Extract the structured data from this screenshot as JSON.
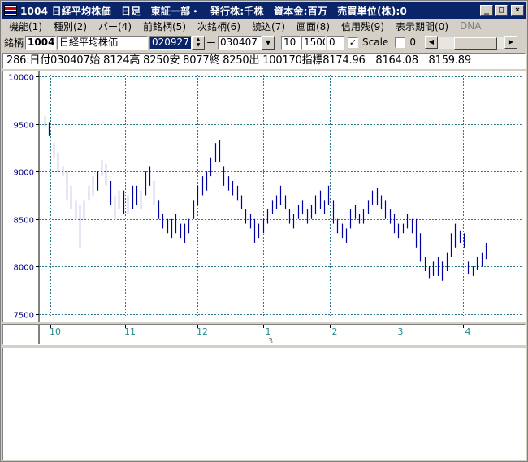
{
  "title": "1004 日経平均株価　日足　東証一部・　発行株:千株　資本金:百万　売買単位(株):0",
  "window_buttons": {
    "minimize": "_",
    "maximize": "□",
    "close": "×"
  },
  "menu": [
    {
      "label": "機能(1)",
      "enabled": true
    },
    {
      "label": "種別(2)",
      "enabled": true
    },
    {
      "label": "バー(4)",
      "enabled": true
    },
    {
      "label": "前銘柄(5)",
      "enabled": true
    },
    {
      "label": "次銘柄(6)",
      "enabled": true
    },
    {
      "label": "読込(7)",
      "enabled": true
    },
    {
      "label": "画面(8)",
      "enabled": true
    },
    {
      "label": "信用残(9)",
      "enabled": true
    },
    {
      "label": "表示期間(0)",
      "enabled": true
    },
    {
      "label": "DNA",
      "enabled": false
    }
  ],
  "toolbar": {
    "stock_label": "銘柄",
    "code": "1004",
    "name": "日経平均株価",
    "date_from": "020927",
    "dash": "ー",
    "date_to": "030407",
    "val1": "10",
    "val2": "1500",
    "val3": "0",
    "scale_checked": "✓",
    "scale_label": "Scale",
    "val4": "0"
  },
  "info_line": "286:日付030407始 8124高 8250安 8077終 8250出 100170指標8174.96　8164.08　8159.89",
  "colors": {
    "bar": "#0000a0",
    "grid": "#2a7a8a",
    "axis_text": "#2a8a8a",
    "price_text": "#000080"
  },
  "chart_data": {
    "type": "bar",
    "subtype": "ohlc-high-low",
    "y_axis": {
      "ticks": [
        10000,
        9500,
        9000,
        8500,
        8000,
        7500
      ],
      "ylim": [
        7480,
        10020
      ]
    },
    "x_axis": {
      "month_labels": [
        "10",
        "11",
        "12",
        "1",
        "2",
        "3",
        "4"
      ],
      "year_label": "3"
    },
    "series": [
      {
        "bars": [
          {
            "high": 9580,
            "low": 9480
          },
          {
            "high": 9520,
            "low": 9380
          },
          {
            "high": 9300,
            "low": 9150
          },
          {
            "high": 9200,
            "low": 9000
          },
          {
            "high": 9050,
            "low": 8950
          },
          {
            "high": 9000,
            "low": 8700
          },
          {
            "high": 8850,
            "low": 8600
          },
          {
            "high": 8700,
            "low": 8500
          },
          {
            "high": 8650,
            "low": 8200
          },
          {
            "high": 8700,
            "low": 8500
          },
          {
            "high": 8850,
            "low": 8700
          },
          {
            "high": 8950,
            "low": 8750
          },
          {
            "high": 9000,
            "low": 8800
          },
          {
            "high": 9120,
            "low": 8950
          },
          {
            "high": 9080,
            "low": 8850
          },
          {
            "high": 8900,
            "low": 8650
          },
          {
            "high": 8750,
            "low": 8500
          },
          {
            "high": 8800,
            "low": 8600
          },
          {
            "high": 8800,
            "low": 8550
          },
          {
            "high": 8750,
            "low": 8550
          },
          {
            "high": 8850,
            "low": 8600
          },
          {
            "high": 8850,
            "low": 8650
          },
          {
            "high": 8800,
            "low": 8600
          },
          {
            "high": 9000,
            "low": 8750
          },
          {
            "high": 9050,
            "low": 8850
          },
          {
            "high": 8900,
            "low": 8650
          },
          {
            "high": 8700,
            "low": 8500
          },
          {
            "high": 8550,
            "low": 8400
          },
          {
            "high": 8500,
            "low": 8350
          },
          {
            "high": 8500,
            "low": 8300
          },
          {
            "high": 8550,
            "low": 8350
          },
          {
            "high": 8450,
            "low": 8300
          },
          {
            "high": 8450,
            "low": 8250
          },
          {
            "high": 8500,
            "low": 8350
          },
          {
            "high": 8700,
            "low": 8500
          },
          {
            "high": 8850,
            "low": 8650
          },
          {
            "high": 8950,
            "low": 8750
          },
          {
            "high": 9000,
            "low": 8800
          },
          {
            "high": 9150,
            "low": 8950
          },
          {
            "high": 9300,
            "low": 9100
          },
          {
            "high": 9330,
            "low": 9100
          },
          {
            "high": 9050,
            "low": 8850
          },
          {
            "high": 8950,
            "low": 8800
          },
          {
            "high": 8900,
            "low": 8750
          },
          {
            "high": 8850,
            "low": 8700
          },
          {
            "high": 8750,
            "low": 8600
          },
          {
            "high": 8600,
            "low": 8450
          },
          {
            "high": 8550,
            "low": 8400
          },
          {
            "high": 8500,
            "low": 8250
          },
          {
            "high": 8450,
            "low": 8300
          },
          {
            "high": 8500,
            "low": 8350
          },
          {
            "high": 8600,
            "low": 8450
          },
          {
            "high": 8700,
            "low": 8550
          },
          {
            "high": 8750,
            "low": 8600
          },
          {
            "high": 8850,
            "low": 8650
          },
          {
            "high": 8750,
            "low": 8600
          },
          {
            "high": 8600,
            "low": 8450
          },
          {
            "high": 8550,
            "low": 8400
          },
          {
            "high": 8650,
            "low": 8500
          },
          {
            "high": 8700,
            "low": 8550
          },
          {
            "high": 8600,
            "low": 8450
          },
          {
            "high": 8650,
            "low": 8500
          },
          {
            "high": 8750,
            "low": 8550
          },
          {
            "high": 8800,
            "low": 8600
          },
          {
            "high": 8700,
            "low": 8550
          },
          {
            "high": 8850,
            "low": 8650
          },
          {
            "high": 8700,
            "low": 8450
          },
          {
            "high": 8500,
            "low": 8350
          },
          {
            "high": 8450,
            "low": 8300
          },
          {
            "high": 8400,
            "low": 8250
          },
          {
            "high": 8600,
            "low": 8400
          },
          {
            "high": 8650,
            "low": 8500
          },
          {
            "high": 8550,
            "low": 8450
          },
          {
            "high": 8600,
            "low": 8450
          },
          {
            "high": 8700,
            "low": 8550
          },
          {
            "high": 8800,
            "low": 8650
          },
          {
            "high": 8830,
            "low": 8650
          },
          {
            "high": 8750,
            "low": 8600
          },
          {
            "high": 8700,
            "low": 8500
          },
          {
            "high": 8600,
            "low": 8450
          },
          {
            "high": 8550,
            "low": 8350
          },
          {
            "high": 8450,
            "low": 8300
          },
          {
            "high": 8450,
            "low": 8350
          },
          {
            "high": 8550,
            "low": 8400
          },
          {
            "high": 8500,
            "low": 8350
          },
          {
            "high": 8500,
            "low": 8200
          },
          {
            "high": 8350,
            "low": 8050
          },
          {
            "high": 8100,
            "low": 7950
          },
          {
            "high": 8000,
            "low": 7870
          },
          {
            "high": 8050,
            "low": 7900
          },
          {
            "high": 8100,
            "low": 7900
          },
          {
            "high": 8050,
            "low": 7850
          },
          {
            "high": 8150,
            "low": 7950
          },
          {
            "high": 8350,
            "low": 8100
          },
          {
            "high": 8450,
            "low": 8200
          },
          {
            "high": 8380,
            "low": 8250
          },
          {
            "high": 8350,
            "low": 8200
          },
          {
            "high": 8050,
            "low": 7920
          },
          {
            "high": 8000,
            "low": 7900
          },
          {
            "high": 8100,
            "low": 7960
          },
          {
            "high": 8150,
            "low": 8000
          },
          {
            "high": 8250,
            "low": 8077
          }
        ]
      }
    ]
  }
}
